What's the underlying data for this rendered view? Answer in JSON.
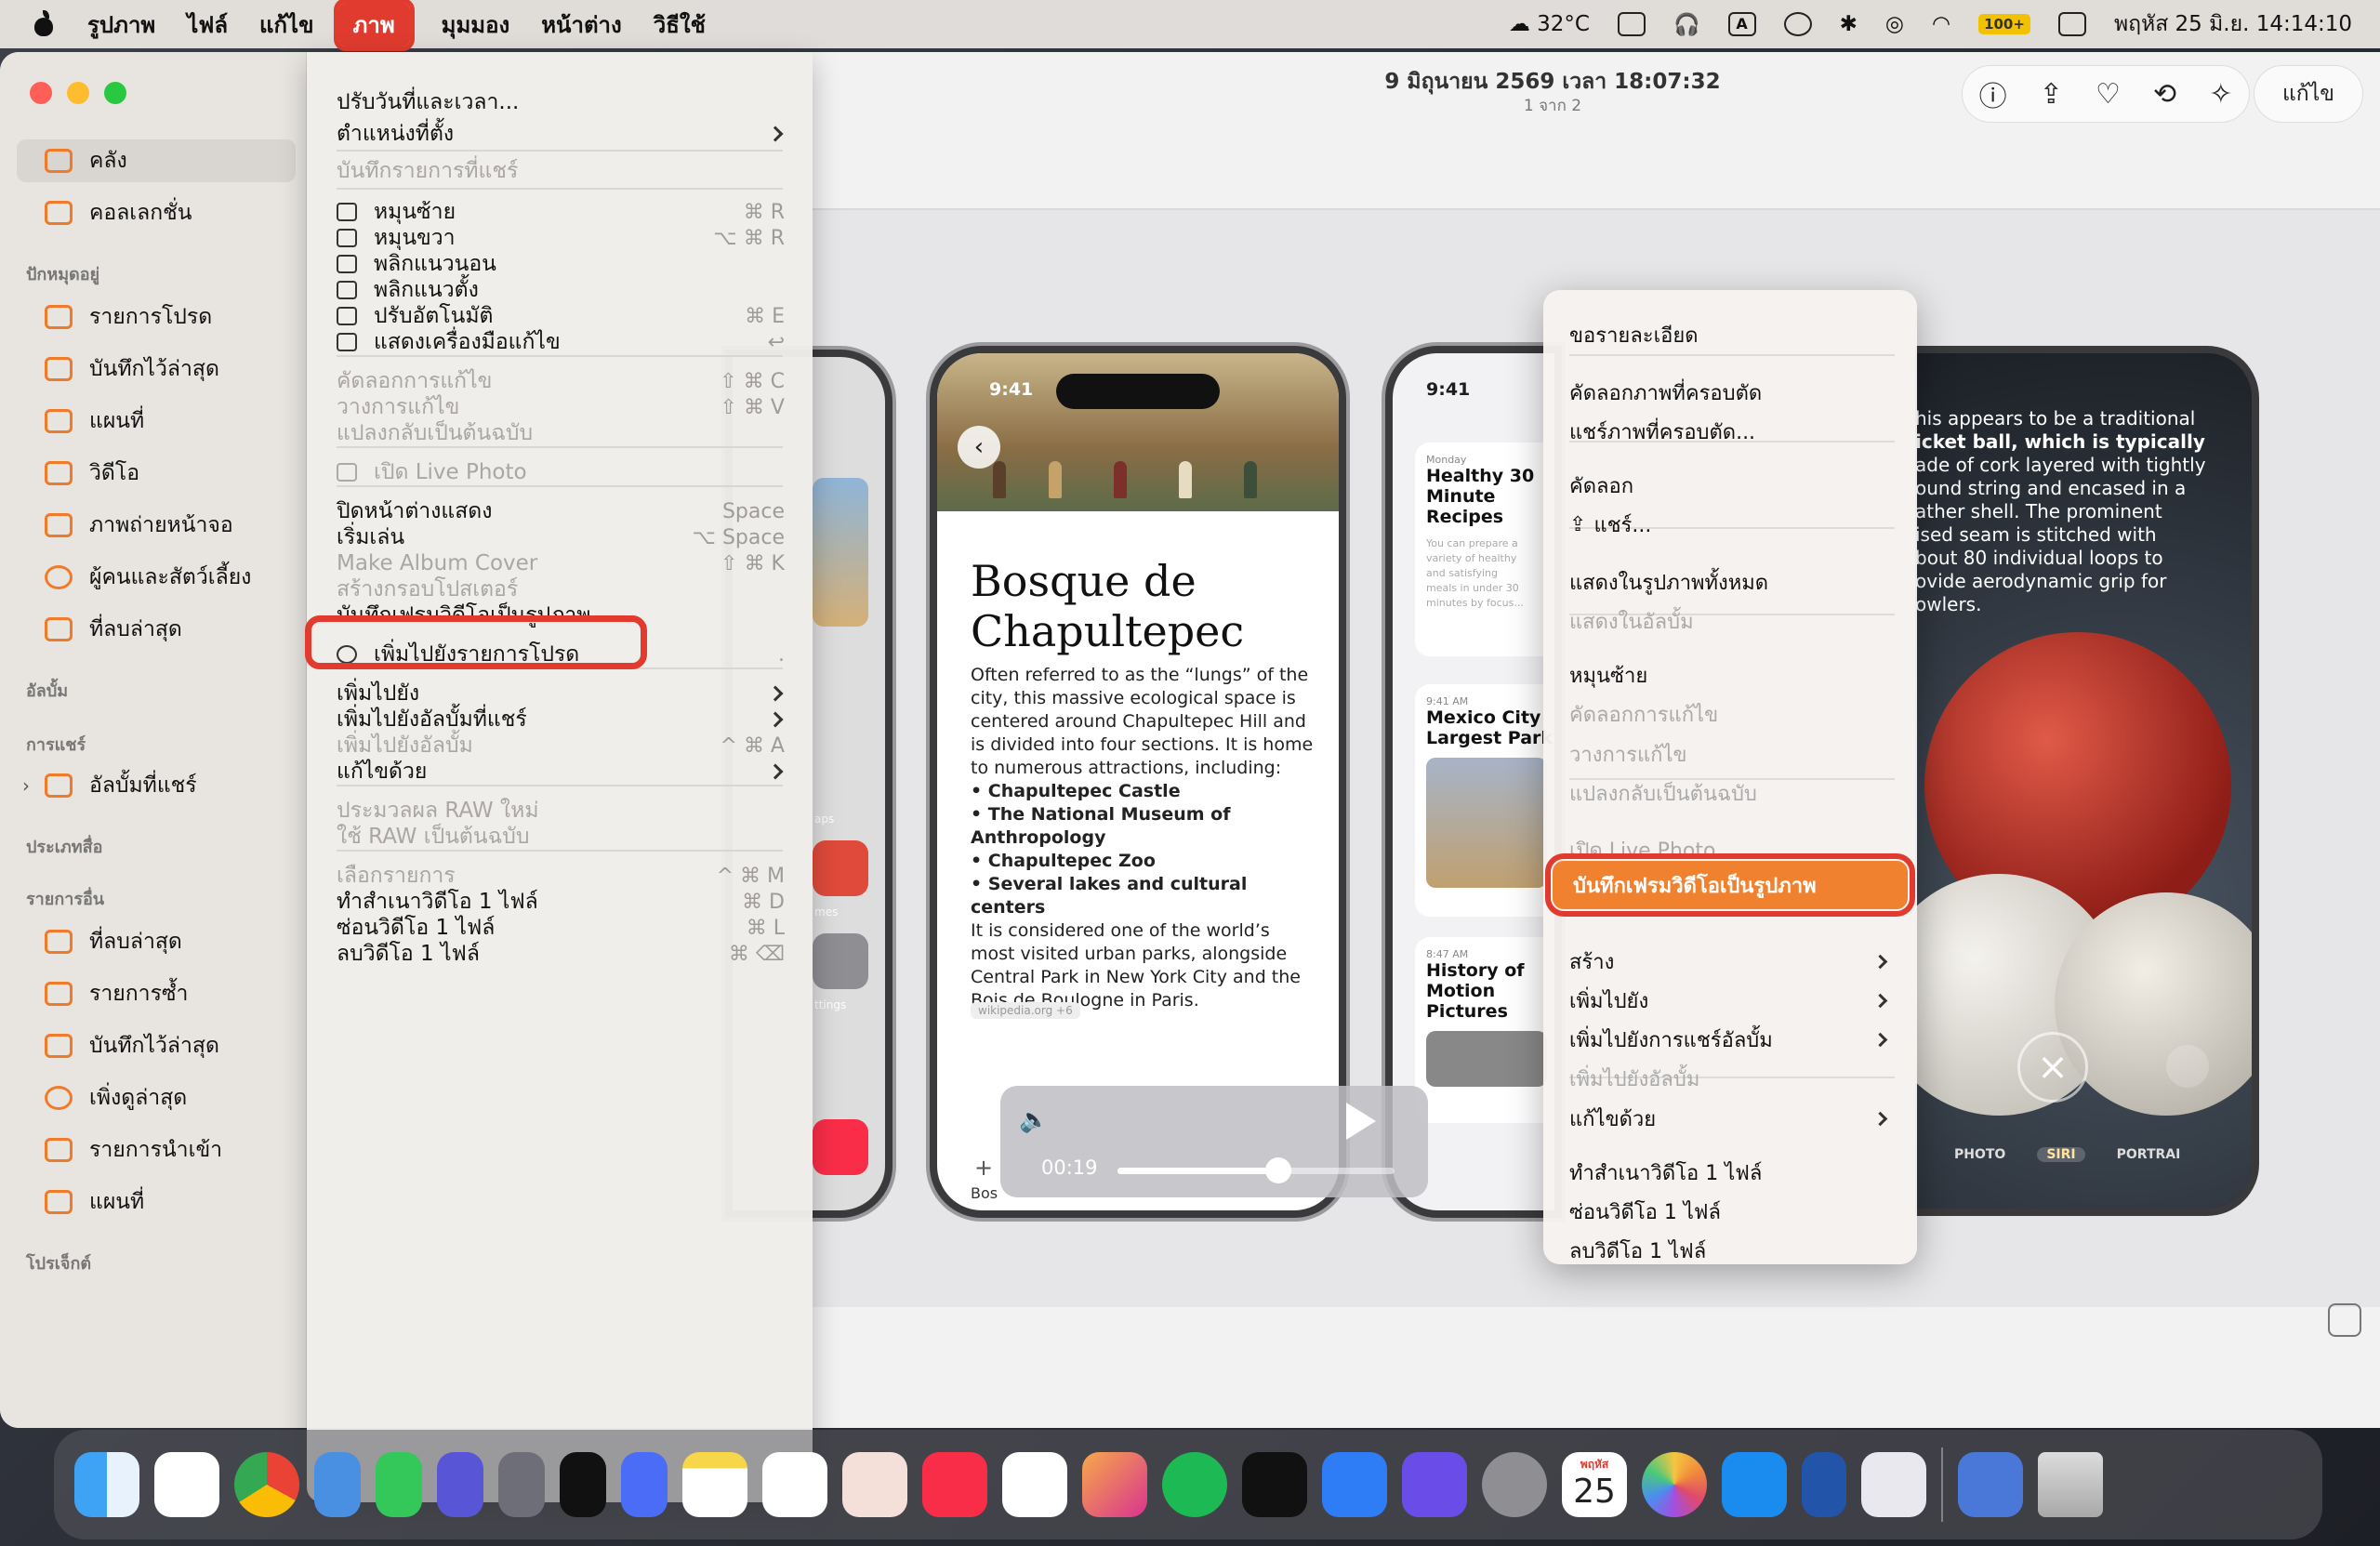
{
  "menubar": {
    "items": [
      "รูปภาพ",
      "ไฟล์",
      "แก้ไข",
      "ภาพ",
      "มุมมอง",
      "หน้าต่าง",
      "วิธีใช้"
    ],
    "active_index": 3,
    "weather": "32°C",
    "battery": "100+",
    "clock": "พฤหัส 25 มิ.ย. 14:14:10"
  },
  "sidebar": {
    "library": [
      {
        "label": "คลัง"
      },
      {
        "label": "คอลเลกชั่น"
      }
    ],
    "pinned_header": "ปักหมุดอยู่",
    "pinned": [
      {
        "label": "รายการโปรด"
      },
      {
        "label": "บันทึกไว้ล่าสุด"
      },
      {
        "label": "แผนที่"
      },
      {
        "label": "วิดีโอ"
      },
      {
        "label": "ภาพถ่ายหน้าจอ"
      },
      {
        "label": "ผู้คนและสัตว์เลี้ยง"
      },
      {
        "label": "ที่ลบล่าสุด"
      }
    ],
    "albums_header": "อัลบั้ม",
    "sharing_header": "การแชร์",
    "shared_albums": "อัลบั้มที่แชร์",
    "media_types_header": "ประเภทสื่อ",
    "other_header": "รายการอื่น",
    "other": [
      {
        "label": "ที่ลบล่าสุด"
      },
      {
        "label": "รายการซ้ำ"
      },
      {
        "label": "บันทึกไว้ล่าสุด"
      },
      {
        "label": "เพิ่งดูล่าสุด"
      },
      {
        "label": "รายการนำเข้า"
      },
      {
        "label": "แผนที่"
      }
    ],
    "projects_header": "โปรเจ็กต์"
  },
  "header": {
    "date": "9 มิถุนายน 2569 เวลา 18:07:32",
    "count": "1 จาก 2",
    "edit_label": "แก้ไข"
  },
  "image_menu": [
    {
      "label": "ปรับวันที่และเวลา...",
      "shortcut": "",
      "disabled": false,
      "submenu": false
    },
    {
      "label": "ตำแหน่งที่ตั้ง",
      "shortcut": "",
      "disabled": false,
      "submenu": true
    },
    {
      "label": "บันทึกรายการที่แชร์",
      "shortcut": "",
      "disabled": true,
      "submenu": false
    },
    {
      "label": "หมุนซ้าย",
      "shortcut": "⌘ R",
      "disabled": false,
      "submenu": false
    },
    {
      "label": "หมุนขวา",
      "shortcut": "⌥ ⌘ R",
      "disabled": false,
      "submenu": false
    },
    {
      "label": "พลิกแนวนอน",
      "shortcut": "",
      "disabled": false,
      "submenu": false
    },
    {
      "label": "พลิกแนวตั้ง",
      "shortcut": "",
      "disabled": false,
      "submenu": false
    },
    {
      "label": "ปรับอัตโนมัติ",
      "shortcut": "⌘ E",
      "disabled": false,
      "submenu": false
    },
    {
      "label": "แสดงเครื่องมือแก้ไข",
      "shortcut": "↩",
      "disabled": false,
      "submenu": false
    },
    {
      "label": "คัดลอกการแก้ไข",
      "shortcut": "⇧ ⌘ C",
      "disabled": true,
      "submenu": false
    },
    {
      "label": "วางการแก้ไข",
      "shortcut": "⇧ ⌘ V",
      "disabled": true,
      "submenu": false
    },
    {
      "label": "แปลงกลับเป็นต้นฉบับ",
      "shortcut": "",
      "disabled": true,
      "submenu": false
    },
    {
      "label": "เปิด Live Photo",
      "shortcut": "",
      "disabled": true,
      "submenu": false
    },
    {
      "label": "ปิดหน้าต่างแสดง",
      "shortcut": "Space",
      "disabled": false,
      "submenu": false
    },
    {
      "label": "เริ่มเล่น",
      "shortcut": "⌥ Space",
      "disabled": false,
      "submenu": false
    },
    {
      "label": "Make Album Cover",
      "shortcut": "⇧ ⌘ K",
      "disabled": true,
      "submenu": false
    },
    {
      "label": "สร้างกรอบโปสเตอร์",
      "shortcut": "",
      "disabled": true,
      "submenu": false
    },
    {
      "label": "บันทึกเฟรมวิดีโอเป็นรูปภาพ",
      "shortcut": "",
      "disabled": false,
      "submenu": false
    },
    {
      "label": "เพิ่มไปยังรายการโปรด",
      "shortcut": ".",
      "disabled": false,
      "submenu": false
    },
    {
      "label": "เพิ่มไปยัง",
      "shortcut": "",
      "disabled": false,
      "submenu": true
    },
    {
      "label": "เพิ่มไปยังอัลบั้มที่แชร์",
      "shortcut": "",
      "disabled": false,
      "submenu": true
    },
    {
      "label": "เพิ่มไปยังอัลบั้ม",
      "shortcut": "^ ⌘ A",
      "disabled": true,
      "submenu": false
    },
    {
      "label": "แก้ไขด้วย",
      "shortcut": "",
      "disabled": false,
      "submenu": true
    },
    {
      "label": "ประมวลผล RAW ใหม่",
      "shortcut": "",
      "disabled": true,
      "submenu": false
    },
    {
      "label": "ใช้ RAW เป็นต้นฉบับ",
      "shortcut": "",
      "disabled": true,
      "submenu": false
    },
    {
      "label": "เลือกรายการ",
      "shortcut": "^ ⌘ M",
      "disabled": true,
      "submenu": false
    },
    {
      "label": "ทำสำเนาวิดีโอ 1 ไฟล์",
      "shortcut": "⌘ D",
      "disabled": false,
      "submenu": false
    },
    {
      "label": "ซ่อนวิดีโอ 1 ไฟล์",
      "shortcut": "⌘ L",
      "disabled": false,
      "submenu": false
    },
    {
      "label": "ลบวิดีโอ 1 ไฟล์",
      "shortcut": "⌘ ⌫",
      "disabled": false,
      "submenu": false
    }
  ],
  "context_menu": [
    {
      "label": "ขอรายละเอียด",
      "disabled": false,
      "submenu": false
    },
    {
      "label": "คัดลอกภาพที่ครอบตัด",
      "disabled": false,
      "submenu": false
    },
    {
      "label": "แชร์ภาพที่ครอบตัด...",
      "disabled": false,
      "submenu": false
    },
    {
      "label": "คัดลอก",
      "disabled": false,
      "submenu": false
    },
    {
      "label": "แชร์...",
      "disabled": false,
      "submenu": false
    },
    {
      "label": "แสดงในรูปภาพทั้งหมด",
      "disabled": false,
      "submenu": false
    },
    {
      "label": "แสดงในอัลบั้ม",
      "disabled": true,
      "submenu": false
    },
    {
      "label": "หมุนซ้าย",
      "disabled": false,
      "submenu": false
    },
    {
      "label": "คัดลอกการแก้ไข",
      "disabled": true,
      "submenu": false
    },
    {
      "label": "วางการแก้ไข",
      "disabled": true,
      "submenu": false
    },
    {
      "label": "แปลงกลับเป็นต้นฉบับ",
      "disabled": true,
      "submenu": false
    },
    {
      "label": "เปิด Live Photo",
      "disabled": true,
      "submenu": false
    },
    {
      "label": "บันทึกเฟรมวิดีโอเป็นรูปภาพ",
      "disabled": false,
      "submenu": false
    },
    {
      "label": "สร้าง",
      "disabled": false,
      "submenu": true
    },
    {
      "label": "เพิ่มไปยัง",
      "disabled": false,
      "submenu": true
    },
    {
      "label": "เพิ่มไปยังการแชร์อัลบั้ม",
      "disabled": false,
      "submenu": true
    },
    {
      "label": "เพิ่มไปยังอัลบั้ม",
      "disabled": true,
      "submenu": false
    },
    {
      "label": "แก้ไขด้วย",
      "disabled": false,
      "submenu": true
    },
    {
      "label": "ทำสำเนาวิดีโอ 1 ไฟล์",
      "disabled": false,
      "submenu": false
    },
    {
      "label": "ซ่อนวิดีโอ 1 ไฟล์",
      "disabled": false,
      "submenu": false
    },
    {
      "label": "ลบวิดีโอ 1 ไฟล์",
      "disabled": false,
      "submenu": false
    }
  ],
  "video": {
    "time": "00:19",
    "progress": 0.58
  },
  "phone_bosque": {
    "time": "9:41",
    "title": "Bosque de Chapultepec",
    "intro": "Often referred to as the “lungs” of the city, this massive ecological space is centered around Chapultepec Hill and is divided into four sections. It is home to numerous attractions, including:",
    "bullets": [
      "Chapultepec Castle",
      "The National Museum of Anthropology",
      "Chapultepec Zoo",
      "Several lakes and cultural centers"
    ],
    "outro": "It is considered one of the world’s most visited urban parks, alongside Central Park in New York City and the Bois de Boulogne in Paris.",
    "source": "wikipedia.org  +6",
    "footer_label": "Bos"
  },
  "phone_cards": {
    "time": "9:41",
    "cards": [
      {
        "meta": "Monday",
        "title": "Healthy 30 Minute Recipes",
        "body": "You can prepare a variety of healthy and satisfying meals in under 30 minutes by focus..."
      },
      {
        "meta": "9:41 AM",
        "title": "Mexico City Largest Park"
      },
      {
        "meta": "8:47 AM",
        "title": "History of Motion Pictures"
      }
    ]
  },
  "phone_cricket": {
    "lines": [
      "his appears to be a traditional",
      "icket ball, which is typically",
      "ade of cork layered with tightly",
      "ound string and encased in a",
      "ather shell. The prominent",
      "ised seam is stitched with",
      "bout 80 individual loops to",
      "ovide aerodynamic grip for",
      "owlers."
    ],
    "modes": [
      "PHOTO",
      "SIRI",
      "PORTRAI"
    ]
  },
  "left_phone_labels": [
    "aps",
    "mes",
    "ttings"
  ],
  "dock_calendar": {
    "month": "พฤหัส",
    "day": "25"
  },
  "colors": {
    "accent_red": "#e03b2e",
    "highlight_orange": "#f0822f"
  }
}
